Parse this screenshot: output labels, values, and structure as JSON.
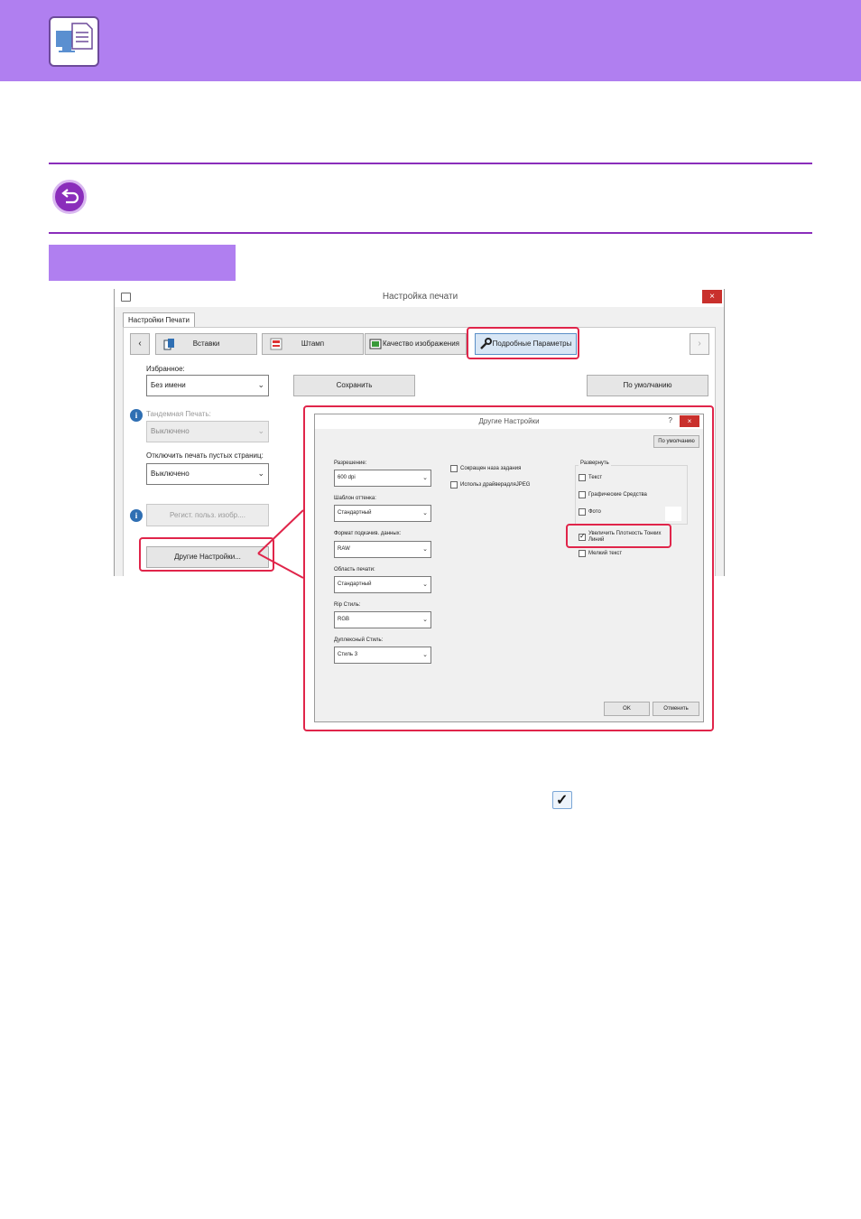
{
  "icons": {
    "header": "printer-monitor-icon",
    "back": "back-arrow-icon",
    "checkbox": "checkbox-checked-icon"
  },
  "colors": {
    "accent": "#b07ff0",
    "rule": "#8a2dbb",
    "highlight": "#e0254a"
  },
  "main_dialog": {
    "title": "Настройка печати",
    "close": "×",
    "tab": "Настройки Печати",
    "prev": "‹",
    "next": "›",
    "tabs": [
      "Вставки",
      "Штамп",
      "Качество изображения",
      "Подробные Параметры"
    ],
    "favorites_label": "Избранное:",
    "favorites_value": "Без имени",
    "save": "Сохранить",
    "defaults": "По умолчанию",
    "tandem_label": "Тандемная Печать:",
    "tandem_value": "Выключено",
    "skip_blank_label": "Отключить печать пустых страниц:",
    "skip_blank_value": "Выключено",
    "register_image": "Регист. польз. изобр....",
    "other_settings": "Другие Настройки..."
  },
  "other_dialog": {
    "title": "Другие Настройки",
    "help": "?",
    "close": "×",
    "defaults": "По умолчанию",
    "resolution_label": "Разрешение:",
    "resolution_value": "600 dpi",
    "halftone_label": "Шаблон оттенка:",
    "halftone_value": "Стандартный",
    "spool_label": "Формат подкачив. данных:",
    "spool_value": "RAW",
    "print_area_label": "Область печати:",
    "print_area_value": "Стандартный",
    "rip_label": "Rip Стиль:",
    "rip_value": "RGB",
    "duplex_label": "Дуплексный Стиль:",
    "duplex_value": "Стиль 3",
    "reduce_job": "Сокращен наза задания",
    "use_jpeg": "Использ драйверадляJPEG",
    "expand_label": "Развернуть",
    "text": "Текст",
    "graphics": "Графические Средства",
    "photo": "Фото",
    "thick_lines": "Увеличить Плотность Тонких Линий",
    "fine_text": "Мелкий текст",
    "ok": "OK",
    "cancel": "Отменить"
  }
}
